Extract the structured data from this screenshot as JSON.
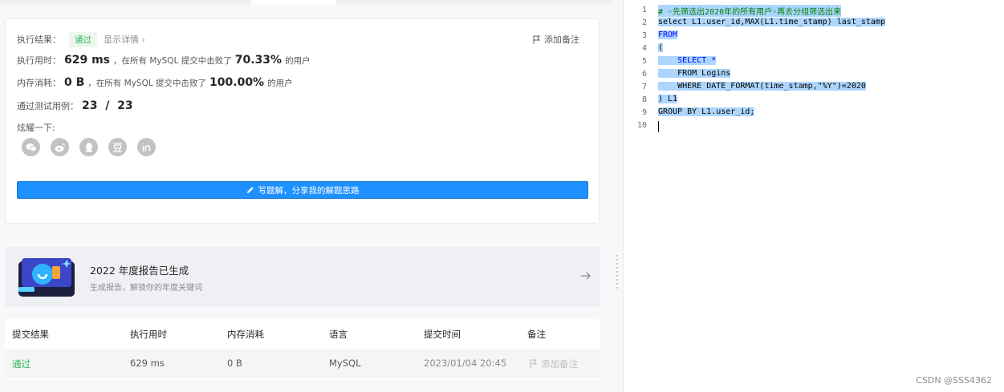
{
  "result": {
    "status_label": "执行结果：",
    "status_value": "通过",
    "detail_link": "显示详情 ›",
    "add_note": "添加备注",
    "time_label": "执行用时：",
    "time_value": "629 ms",
    "time_mid": "，在所有 MySQL 提交中击败了",
    "time_percent": "70.33%",
    "time_tail": "的用户",
    "mem_label": "内存消耗：",
    "mem_value": "0 B",
    "mem_mid": "，在所有 MySQL 提交中击败了",
    "mem_percent": "100.00%",
    "mem_tail": "的用户",
    "tests_label": "通过测试用例：",
    "tests_value": "23  /  23",
    "share_label": "炫耀一下:",
    "share_icons": [
      "wechat-icon",
      "weibo-icon",
      "qq-icon",
      "douban-icon",
      "linkedin-icon"
    ],
    "write_button": "写题解，分享我的解题思路"
  },
  "report": {
    "title": "2022 年度报告已生成",
    "subtitle": "生成报告，解锁你的年度关键词"
  },
  "submissions": {
    "headers": [
      "提交结果",
      "执行用时",
      "内存消耗",
      "语言",
      "提交时间",
      "备注"
    ],
    "rows": [
      {
        "result": "通过",
        "time": "629 ms",
        "memory": "0 B",
        "language": "MySQL",
        "submitted": "2023/01/04 20:45",
        "note": "添加备注"
      }
    ]
  },
  "editor": {
    "line_numbers": [
      "1",
      "2",
      "3",
      "4",
      "5",
      "6",
      "7",
      "8",
      "9",
      "10"
    ],
    "lines": [
      "# ◦先筛选出2020年的所有用户◦再去分组筛选出来",
      "select L1.user_id,MAX(L1.time_stamp) last_stamp",
      "FROM",
      "(",
      "    SELECT *",
      "    FROM Logins",
      "    WHERE DATE_FORMAT(time_stamp,\"%Y\")=2020",
      ") L1",
      "GROUP BY L1.user_id;",
      ""
    ]
  },
  "watermark": "CSDN @SSS4362",
  "colors": {
    "accent": "#1e90ff",
    "success": "#2db55d",
    "selection": "#add6ff"
  }
}
